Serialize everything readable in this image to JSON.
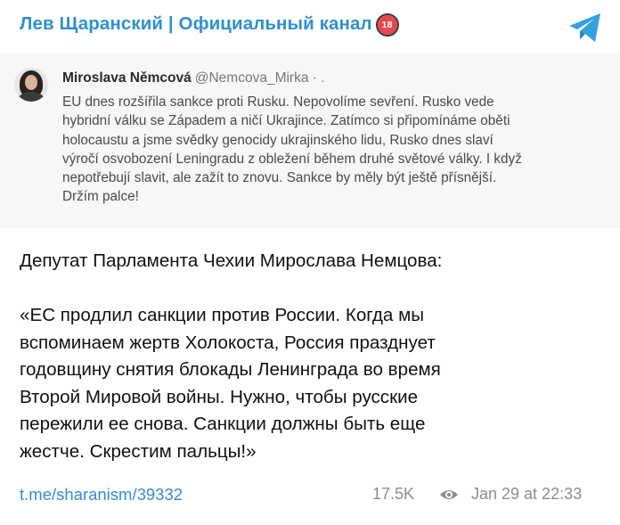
{
  "channel": {
    "title": "Лев Щаранский | Официальный канал",
    "age_badge": "18",
    "brand_color": "#2f8fd3"
  },
  "tweet": {
    "author_name": "Miroslava Němcová",
    "author_handle": "@Nemcova_Mirka · .",
    "lines": [
      "EU dnes rozšířila sankce proti Rusku. Nepovolíme sevření. Rusko vede",
      "hybridní válku se Západem a ničí Ukrajince. Zatímco si připomínáme oběti",
      "holocaustu a jsme svědky genocidy ukrajinského lidu, Rusko dnes slaví",
      "výročí osvobození Leningradu z obležení během druhé světové války. I když",
      "nepotřebují slavit, ale zažít to znovu. Sankce by měly být ještě přísnější.",
      "Držím palce!"
    ]
  },
  "post": {
    "intro": "Депутат Парламента Чехии Мирослава Немцова:",
    "quote_lines": [
      "«ЕС продлил санкции против России. Когда мы",
      "вспоминаем жертв Холокоста, Россия празднует",
      "годовщину снятия блокады Ленинграда во время",
      "Второй Мировой войны. Нужно, чтобы русские",
      "пережили ее снова. Санкции должны быть еще",
      "жестче. Скрестим пальцы!»"
    ]
  },
  "footer": {
    "link": "t.me/sharanism/39332",
    "views": "17.5K",
    "date": "Jan 29 at 22:33"
  },
  "icons": {
    "telegram": "telegram-plane-icon",
    "views": "eye-icon"
  }
}
